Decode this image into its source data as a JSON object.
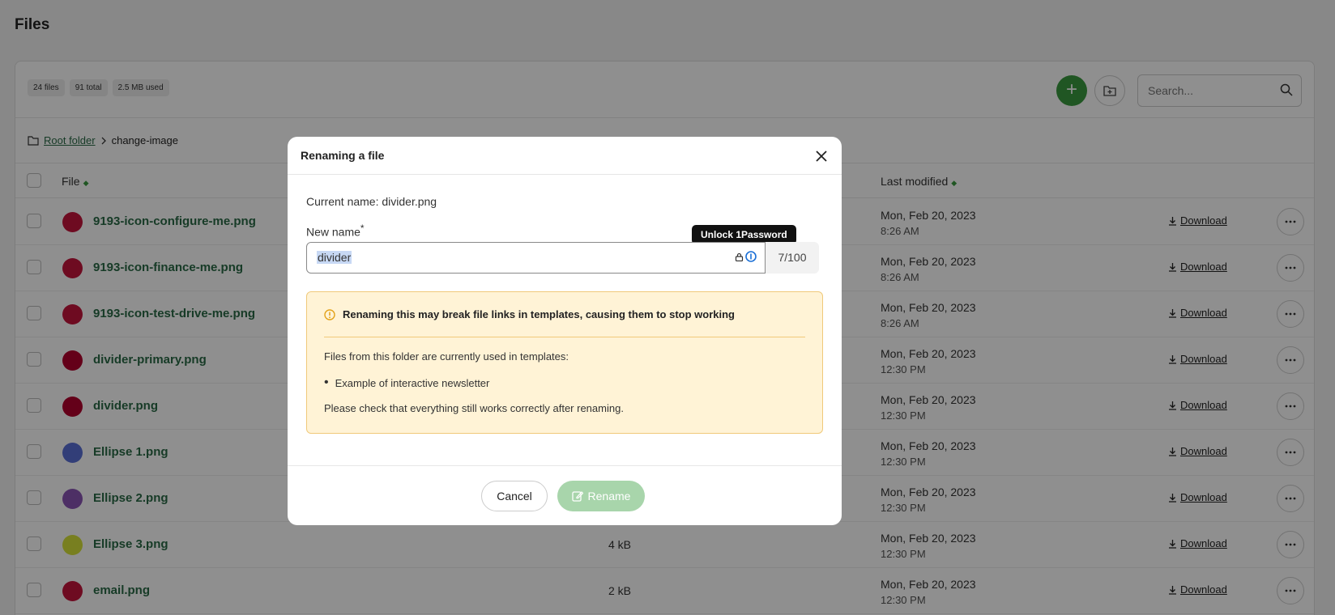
{
  "page": {
    "title": "Files"
  },
  "toolbar": {
    "stats": [
      "24 files",
      "91 total",
      "2.5 MB used"
    ],
    "add_label": "+",
    "search_placeholder": "Search..."
  },
  "breadcrumb": {
    "root": "Root folder",
    "current": "change-image"
  },
  "table": {
    "headers": {
      "file": "File",
      "modified": "Last modified"
    },
    "download_label": "Download",
    "rows": [
      {
        "name": "9193-icon-configure-me.png",
        "size": "",
        "date": "Mon, Feb 20, 2023",
        "time": "8:26 AM",
        "color": "#c4143c"
      },
      {
        "name": "9193-icon-finance-me.png",
        "size": "",
        "date": "Mon, Feb 20, 2023",
        "time": "8:26 AM",
        "color": "#c4143c"
      },
      {
        "name": "9193-icon-test-drive-me.png",
        "size": "",
        "date": "Mon, Feb 20, 2023",
        "time": "8:26 AM",
        "color": "#c4143c"
      },
      {
        "name": "divider-primary.png",
        "size": "",
        "date": "Mon, Feb 20, 2023",
        "time": "12:30 PM",
        "color": "#b3002d"
      },
      {
        "name": "divider.png",
        "size": "",
        "date": "Mon, Feb 20, 2023",
        "time": "12:30 PM",
        "color": "#b3002d"
      },
      {
        "name": "Ellipse 1.png",
        "size": "",
        "date": "Mon, Feb 20, 2023",
        "time": "12:30 PM",
        "color": "#5a6fd6"
      },
      {
        "name": "Ellipse 2.png",
        "size": "",
        "date": "Mon, Feb 20, 2023",
        "time": "12:30 PM",
        "color": "#8a55b5"
      },
      {
        "name": "Ellipse 3.png",
        "size": "4 kB",
        "date": "Mon, Feb 20, 2023",
        "time": "12:30 PM",
        "color": "#d6e33a"
      },
      {
        "name": "email.png",
        "size": "2 kB",
        "date": "Mon, Feb 20, 2023",
        "time": "12:30 PM",
        "color": "#c4143c"
      }
    ]
  },
  "modal": {
    "title": "Renaming a file",
    "current_name": "Current name: divider.png",
    "new_name_label": "New name",
    "required_mark": "*",
    "new_name_value": "divider",
    "counter": "7/100",
    "tooltip": "Unlock 1Password",
    "warning_title": "Renaming this may break file links in templates, causing them to stop working",
    "warning_text": "Files from this folder are currently used in templates:",
    "warning_item": "Example of interactive newsletter",
    "warning_footer": "Please check that everything still works correctly after renaming.",
    "cancel_label": "Cancel",
    "rename_label": "Rename"
  },
  "colors": {
    "accent": "#3a9a3f",
    "link": "#2a6a46",
    "warning_bg": "#fff3d6",
    "warning_border": "#f0c97a"
  }
}
